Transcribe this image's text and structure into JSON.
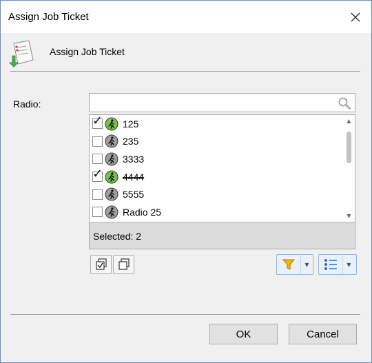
{
  "window": {
    "title": "Assign Job Ticket",
    "close_symbol": "✕"
  },
  "header": {
    "title": "Assign Job Ticket",
    "icon": "assign-ticket-icon"
  },
  "form": {
    "radio_label": "Radio:",
    "search": {
      "value": "",
      "placeholder": "",
      "icon": "search-icon"
    }
  },
  "radios": {
    "items": [
      {
        "label": "125",
        "checked": true,
        "status": "active",
        "strikethrough": false
      },
      {
        "label": "235",
        "checked": false,
        "status": "inactive",
        "strikethrough": false
      },
      {
        "label": "3333",
        "checked": false,
        "status": "inactive",
        "strikethrough": false
      },
      {
        "label": "4444",
        "checked": true,
        "status": "active",
        "strikethrough": true
      },
      {
        "label": "5555",
        "checked": false,
        "status": "inactive",
        "strikethrough": false
      },
      {
        "label": "Radio 25",
        "checked": false,
        "status": "inactive",
        "strikethrough": false
      }
    ],
    "check_mark": "✓",
    "selected_text": "Selected: 2"
  },
  "toolbar": {
    "select_all_icon": "select-all-icon",
    "deselect_all_icon": "deselect-all-icon",
    "filter_icon": "filter-icon",
    "list_view_icon": "list-view-icon",
    "dropdown_arrow": "▼"
  },
  "footer": {
    "ok_label": "OK",
    "cancel_label": "Cancel"
  },
  "colors": {
    "active_status": "#7cc242",
    "inactive_status": "#9e9e9e",
    "filter": "#f5b800",
    "accent_blue": "#2a6ed8"
  }
}
